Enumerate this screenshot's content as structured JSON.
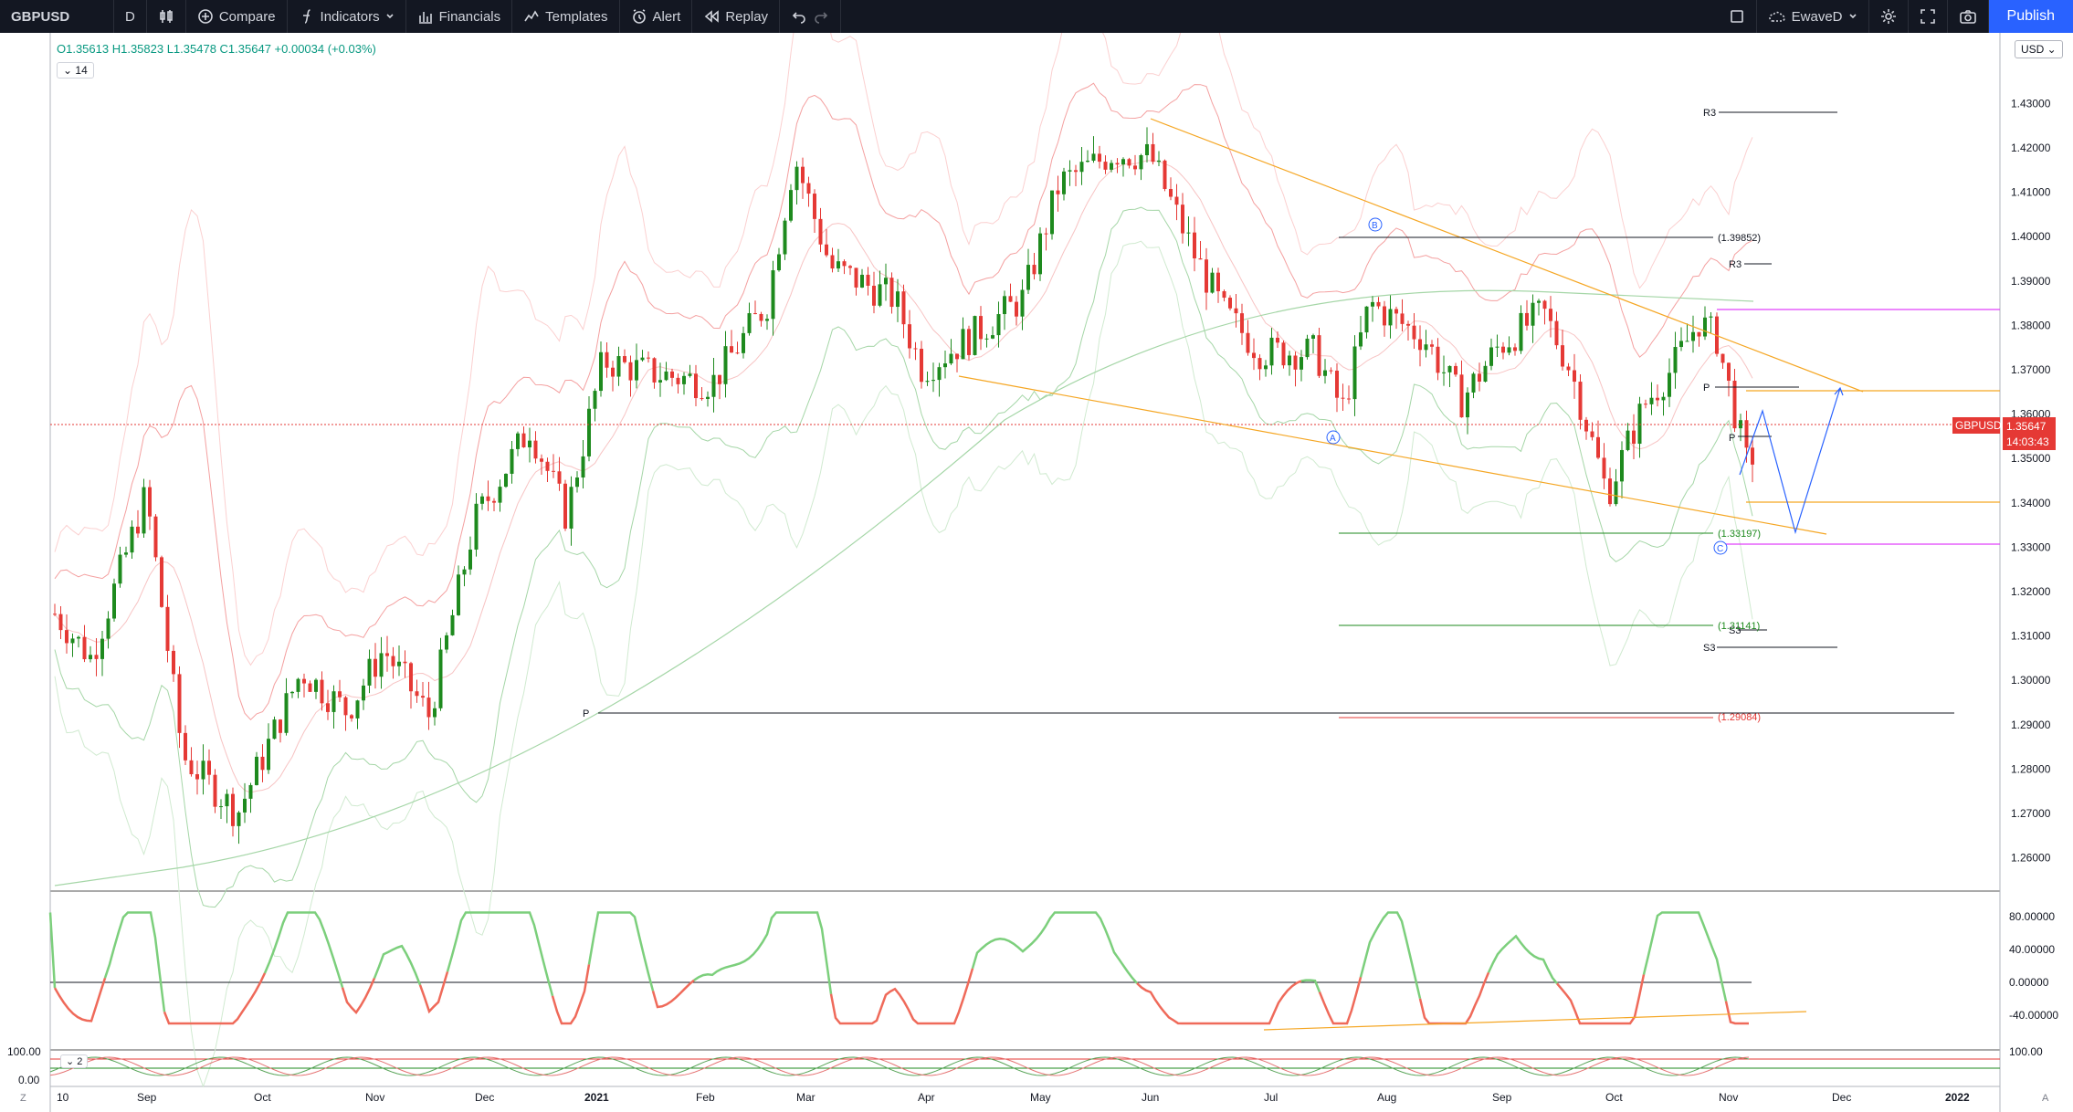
{
  "toolbar": {
    "symbol": "GBPUSD",
    "interval": "D",
    "compare": "Compare",
    "indicators": "Indicators",
    "financials": "Financials",
    "templates": "Templates",
    "alert": "Alert",
    "replay": "Replay",
    "layout_name": "EwaveD",
    "publish": "Publish"
  },
  "legend": {
    "ohlc": "O1.35613 H1.35823 L1.35478 C1.35647 +0.00034 (+0.03%)",
    "length": "14",
    "length2": "2"
  },
  "price_scale": {
    "currency": "USD",
    "ticks": [
      "1.43000",
      "1.42000",
      "1.41000",
      "1.40000",
      "1.39000",
      "1.38000",
      "1.37000",
      "1.36000",
      "1.35000",
      "1.34000",
      "1.33000",
      "1.32000",
      "1.31000",
      "1.30000",
      "1.29000",
      "1.28000",
      "1.27000",
      "1.26000"
    ],
    "last_symbol": "GBPUSD",
    "last_price": "1.35647",
    "countdown": "14:03:43"
  },
  "osc_scale": {
    "ticks": [
      "80.00000",
      "40.00000",
      "0.00000",
      "-40.00000"
    ]
  },
  "stoch_scale": {
    "ticks_right": [
      "100.00"
    ],
    "ticks_left": [
      "100.00",
      "0.00"
    ]
  },
  "time_axis": {
    "labels": [
      "10",
      "Sep",
      "Oct",
      "Nov",
      "Dec",
      "2021",
      "Feb",
      "Mar",
      "Apr",
      "May",
      "Jun",
      "Jul",
      "Aug",
      "Sep",
      "Oct",
      "Nov",
      "Dec",
      "2022"
    ]
  },
  "annotations": {
    "wave_a": "A",
    "wave_b": "B",
    "wave_c": "C",
    "level_1": "(1.39852)",
    "level_2": "(1.33197)",
    "level_3": "(1.31141)",
    "level_4": "(1.29084)",
    "r3_top": "R3",
    "r3_mid": "R3",
    "s3": "S3",
    "s3_small": "S3",
    "p_left": "P",
    "p_right": "P",
    "p_right2": "P"
  },
  "footer": {
    "z": "Z",
    "a": "A"
  },
  "colors": {
    "up": "#1e8a1e",
    "down": "#e53935",
    "orange": "#f5a623",
    "magenta": "#e040fb",
    "blue": "#2962ff",
    "toolbar": "#131722"
  }
}
